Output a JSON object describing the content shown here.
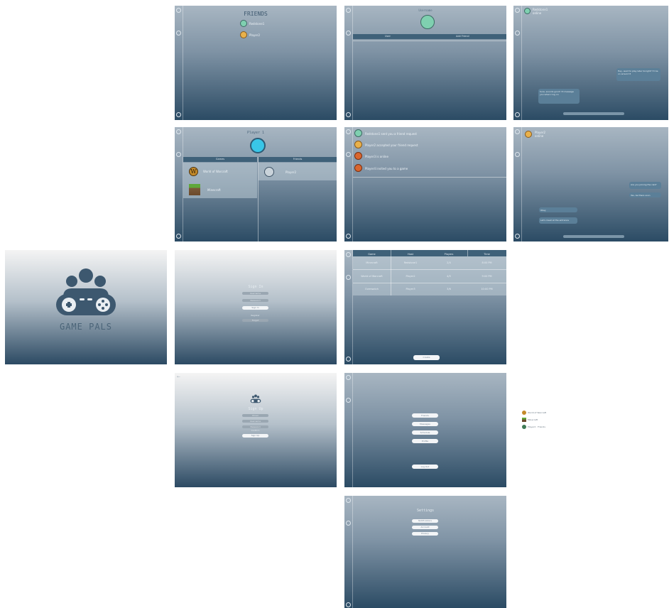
{
  "splash": {
    "app_name": "GAME PALS"
  },
  "friends": {
    "title": "FRIENDS",
    "items": [
      {
        "name": "Redstone1"
      },
      {
        "name": "Player2"
      }
    ]
  },
  "search": {
    "title": "Username",
    "columns": [
      "User",
      "Add Friend"
    ]
  },
  "chat1": {
    "user": "Redstone1",
    "status": "online",
    "messages": [
      "Hey, want to play later tonight? I'll be on around 8",
      "Sure, sounds good! I'll message you when I log on"
    ]
  },
  "profile": {
    "name": "Player 1",
    "columns": [
      "Games",
      "Friends"
    ],
    "games": [
      "World of Warcraft",
      "Minecraft"
    ],
    "friends": [
      "Player2"
    ]
  },
  "requests": {
    "items": [
      "Redstone1 sent you a friend request",
      "Player2 accepted your friend request",
      "Player3 is online",
      "Player4 invited you to a game"
    ]
  },
  "chat2": {
    "user": "Player2",
    "status": "online",
    "messages": [
      "Are you joining the raid?",
      "Yes, be there soon",
      "Okay",
      "Let's meet at the entrance"
    ]
  },
  "signin": {
    "title": "Sign In",
    "username_placeholder": "Username",
    "password_placeholder": "Password",
    "signin_button": "Sign In",
    "register_link": "Register",
    "forgot_link": "Forgot"
  },
  "schedule": {
    "columns": [
      "Game",
      "Host",
      "Players",
      "Time"
    ],
    "rows": [
      [
        "Minecraft",
        "Redstone1",
        "2/4",
        "8:00 PM"
      ],
      [
        "World of Warcraft",
        "Player2",
        "4/5",
        "9:00 PM"
      ],
      [
        "Overwatch",
        "Player3",
        "3/6",
        "10:00 PM"
      ]
    ],
    "create_button": "Create"
  },
  "signup": {
    "title": "Sign Up",
    "fields": [
      "Email",
      "Username",
      "Password",
      "Confirm"
    ],
    "submit_button": "Sign Up"
  },
  "menu": {
    "buttons": [
      "Friends",
      "Messages",
      "Schedule",
      "Profile"
    ],
    "logout_button": "Log Out"
  },
  "settings": {
    "title": "Settings",
    "buttons": [
      "Notifications",
      "Account",
      "Privacy"
    ]
  },
  "mini_list": {
    "items": [
      "World of Warcraft",
      "Minecraft",
      "Player2 · Friends"
    ]
  },
  "colors": {
    "primary": "#3d586f",
    "header": "#3f6179",
    "bubble": "#5b7f98",
    "gradient_top": "#a8b6c2",
    "gradient_bottom": "#2b4b64"
  }
}
